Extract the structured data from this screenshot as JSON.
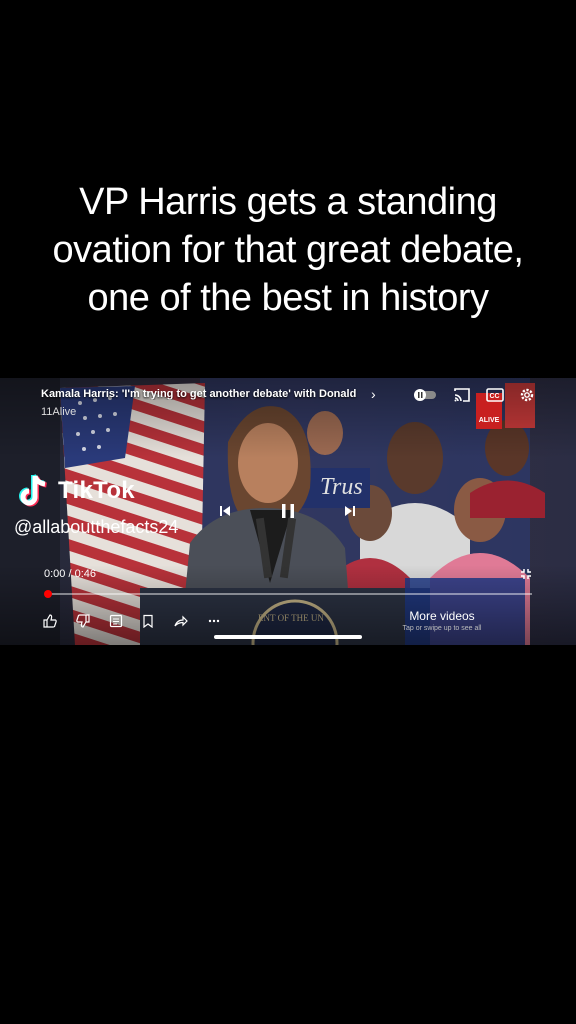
{
  "overlay_caption": "VP Harris gets a standing ovation for that great debate, one of the best in history",
  "video": {
    "title": "Kamala Harris: 'I'm trying to get another debate' with Donald",
    "channel": "11Alive",
    "station_badge": "ALIVE",
    "sign_text": "Trus",
    "time_display": "0:00 / 0:46",
    "progress_fraction": 0.0,
    "more_videos_label": "More videos",
    "more_videos_sub": "Tap or swipe up to see all",
    "seal_text": "ENT OF THE UN"
  },
  "watermark": {
    "brand": "TikTok",
    "username": "@allaboutthefacts24"
  },
  "icons": {
    "top": [
      "chevron-right-icon",
      "autoplay-toggle-icon",
      "cast-icon",
      "captions-icon",
      "settings-icon"
    ],
    "center": [
      "previous-icon",
      "pause-icon",
      "next-icon"
    ],
    "bottom": [
      "like-icon",
      "dislike-icon",
      "comments-icon",
      "save-icon",
      "share-icon",
      "more-icon"
    ]
  },
  "colors": {
    "progress": "#ff0000",
    "background": "#000000"
  }
}
